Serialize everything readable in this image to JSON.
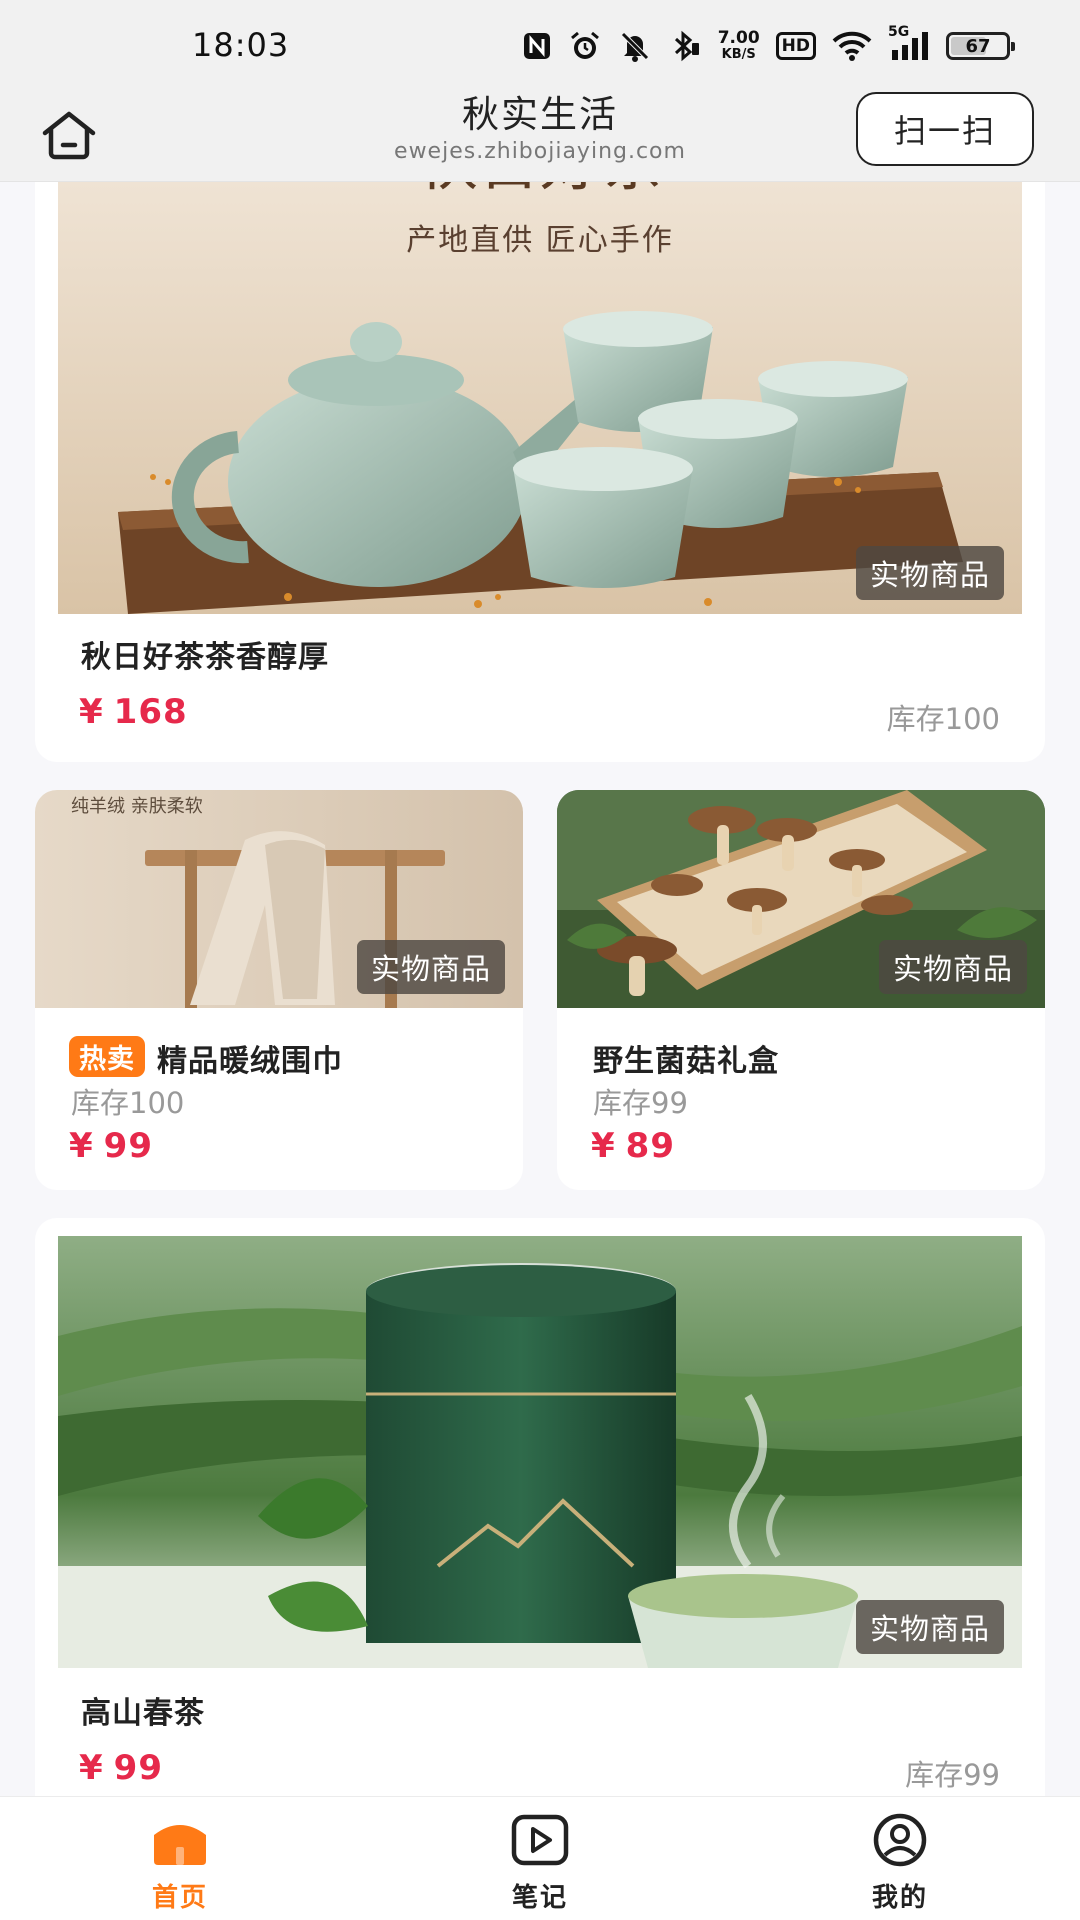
{
  "status_bar": {
    "time": "18:03",
    "speed_value": "7.00",
    "speed_unit": "KB/S",
    "hd_label": "HD",
    "signal_label": "5G",
    "battery_level": "67",
    "battery_fraction": 0.67,
    "icons": [
      "nfc-icon",
      "alarm-icon",
      "mute-icon",
      "bluetooth-icon",
      "wifi-icon",
      "cell-signal-icon",
      "battery-icon"
    ]
  },
  "header": {
    "title": "秋实生活",
    "subtitle": "ewejes.zhibojiaying.com",
    "scan_label": "扫一扫",
    "home_icon": "home-icon"
  },
  "products": [
    {
      "title": "秋日好茶茶香醇厚",
      "price": "168",
      "stock": "库存100",
      "tag": "实物商品",
      "image_banner_title": "秋日好茶",
      "image_banner_sub": "产地直供  匠心手作"
    },
    {
      "title": "精品暖绒围巾",
      "hot_label": "热卖",
      "price": "99",
      "stock": "库存100",
      "tag": "实物商品",
      "image_caption": "纯羊绒 亲肤柔软"
    },
    {
      "title": "野生菌菇礼盒",
      "price": "89",
      "stock": "库存99",
      "tag": "实物商品"
    },
    {
      "title": "高山春茶",
      "price": "99",
      "stock": "库存99",
      "tag": "实物商品"
    }
  ],
  "currency_symbol": "¥",
  "tab_bar": {
    "tabs": [
      {
        "label": "首页",
        "icon": "home-tab-icon",
        "active": true
      },
      {
        "label": "笔记",
        "icon": "play-notes-icon",
        "active": false
      },
      {
        "label": "我的",
        "icon": "profile-icon",
        "active": false
      }
    ]
  },
  "colors": {
    "accent": "#ff7a16",
    "price": "#e6294b",
    "badge_bg": "#4e4842",
    "muted_text": "#999999",
    "background": "#f7f7fa"
  }
}
